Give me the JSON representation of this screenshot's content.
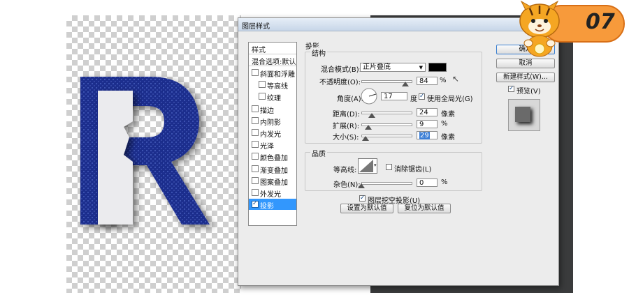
{
  "dialog": {
    "title": "图层样式"
  },
  "sidebar": {
    "header_styles": "样式",
    "header_blend": "混合选项:默认",
    "items": [
      {
        "label": "斜面和浮雕",
        "checked": false,
        "indent": false
      },
      {
        "label": "等高线",
        "checked": false,
        "indent": true
      },
      {
        "label": "纹理",
        "checked": false,
        "indent": true
      },
      {
        "label": "描边",
        "checked": false,
        "indent": false
      },
      {
        "label": "内阴影",
        "checked": false,
        "indent": false
      },
      {
        "label": "内发光",
        "checked": false,
        "indent": false
      },
      {
        "label": "光泽",
        "checked": false,
        "indent": false
      },
      {
        "label": "颜色叠加",
        "checked": false,
        "indent": false
      },
      {
        "label": "渐变叠加",
        "checked": false,
        "indent": false
      },
      {
        "label": "图案叠加",
        "checked": false,
        "indent": false
      },
      {
        "label": "外发光",
        "checked": false,
        "indent": false
      },
      {
        "label": "投影",
        "checked": true,
        "indent": false,
        "selected": true
      }
    ]
  },
  "drop_shadow": {
    "section_title": "投影",
    "structure": {
      "title": "结构",
      "blend_mode_label": "混合模式(B):",
      "blend_mode_value": "正片叠底",
      "shadow_color": "#000000",
      "opacity_label": "不透明度(O):",
      "opacity_value": "84",
      "opacity_unit": "%",
      "angle_label": "角度(A):",
      "angle_value": "17",
      "angle_unit": "度",
      "global_light_label": "使用全局光(G)",
      "global_light_checked": true,
      "distance_label": "距离(D):",
      "distance_value": "24",
      "distance_unit": "像素",
      "spread_label": "扩展(R):",
      "spread_value": "9",
      "spread_unit": "%",
      "size_label": "大小(S):",
      "size_value": "29",
      "size_unit": "像素"
    },
    "quality": {
      "title": "品质",
      "contour_label": "等高线:",
      "anti_alias_label": "消除锯齿(L)",
      "anti_alias_checked": false,
      "noise_label": "杂色(N):",
      "noise_value": "0",
      "noise_unit": "%"
    },
    "knockout_label": "图层挖空投影(U)",
    "knockout_checked": true,
    "set_default_label": "设置为默认值",
    "reset_default_label": "复位为默认值"
  },
  "right_panel": {
    "ok_label": "确定",
    "cancel_label": "取消",
    "new_style_label": "新建样式(W)...",
    "preview_label": "预览(V)",
    "preview_checked": true
  },
  "badge": {
    "number": "07"
  },
  "canvas": {
    "letter": "R",
    "letter_color": "#1c2f8c"
  }
}
